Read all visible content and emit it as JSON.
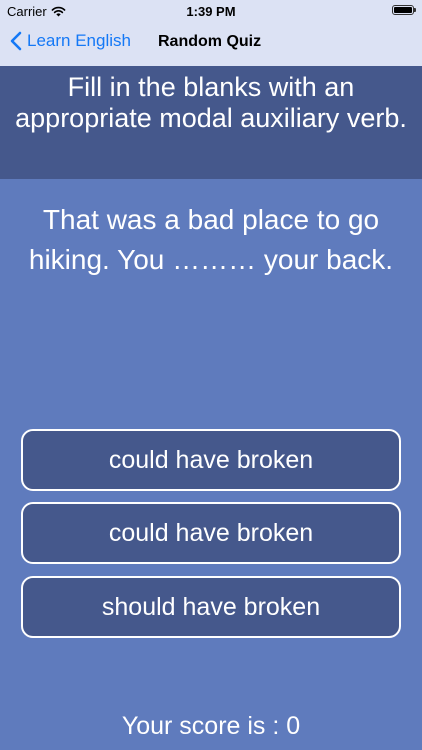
{
  "status_bar": {
    "carrier": "Carrier",
    "time": "1:39 PM",
    "wifi_icon": "wifi-icon",
    "battery_icon": "battery-icon"
  },
  "nav": {
    "back_label": "Learn English",
    "back_icon": "chevron-left-icon",
    "title": "Random Quiz"
  },
  "quiz": {
    "instruction": "Fill in the blanks with an appropriate modal auxiliary verb.",
    "question": "That was a bad place to go hiking. You ……… your back.",
    "answers": [
      {
        "label": "could have broken"
      },
      {
        "label": "could have broken"
      },
      {
        "label": "should have broken"
      }
    ],
    "score_text": "Your score is : 0"
  },
  "colors": {
    "background": "#5f7bbd",
    "panel": "#45588c",
    "nav_background": "#dce2f4",
    "accent": "#1478f6",
    "text_light": "#ffffff"
  }
}
